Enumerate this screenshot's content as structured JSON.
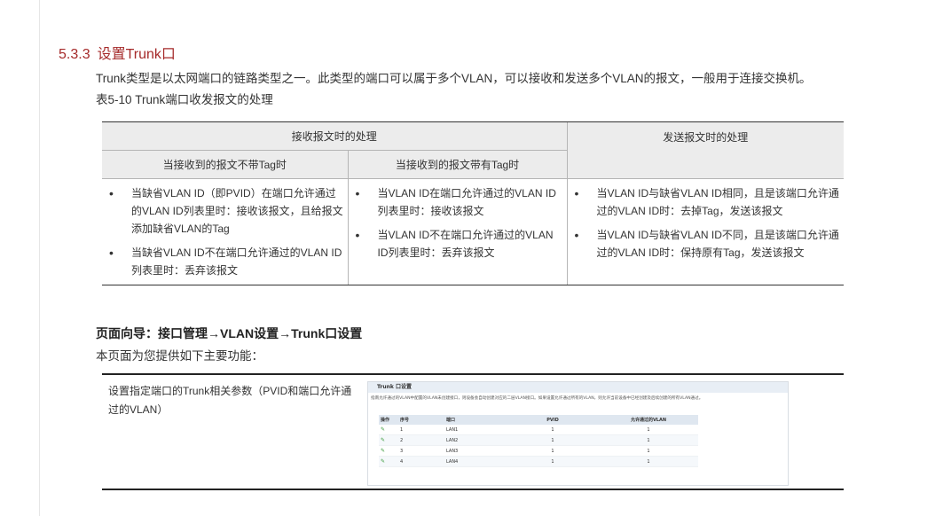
{
  "section": {
    "number": "5.3.3",
    "title": "设置Trunk口"
  },
  "intro_paragraph": "Trunk类型是以太网端口的链路类型之一。此类型的端口可以属于多个VLAN，可以接收和发送多个VLAN的报文，一般用于连接交换机。",
  "table_caption": "表5-10 Trunk端口收发报文的处理",
  "process_table": {
    "receive_header": "接收报文时的处理",
    "send_header": "发送报文时的处理",
    "untagged_header": "当接收到的报文不带Tag时",
    "tagged_header": "当接收到的报文带有Tag时",
    "untagged_items": [
      "当缺省VLAN ID（即PVID）在端口允许通过的VLAN ID列表里时：接收该报文，且给报文添加缺省VLAN的Tag",
      "当缺省VLAN ID不在端口允许通过的VLAN ID列表里时：丢弃该报文"
    ],
    "tagged_items": [
      "当VLAN ID在端口允许通过的VLAN ID列表里时：接收该报文",
      "当VLAN ID不在端口允许通过的VLAN ID列表里时：丢弃该报文"
    ],
    "send_items": [
      "当VLAN ID与缺省VLAN ID相同，且是该端口允许通过的VLAN ID时：去掉Tag，发送该报文",
      "当VLAN ID与缺省VLAN ID不同，且是该端口允许通过的VLAN ID时：保持原有Tag，发送该报文"
    ]
  },
  "page_guide": "页面向导：接口管理→VLAN设置→Trunk口设置",
  "features_intro": "本页面为您提供如下主要功能：",
  "feature": {
    "description": "设置指定端口的Trunk相关参数（PVID和端口允许通过的VLAN）",
    "screenshot": {
      "title": "Trunk 口设置",
      "note": "指南允许通过的VLAN中配置的VLAN未创建接口，则设备会自动创建对应的二层VLAN接口。如果设置允许通过所有的VLAN，则允许当前设备中已经创建及后续创建的所有VLAN通过。",
      "columns": [
        "操作",
        "序号",
        "端口",
        "PVID",
        "允许通过的VLAN"
      ],
      "rows": [
        {
          "no": "1",
          "port": "LAN1",
          "pvid": "1",
          "vlan": "1"
        },
        {
          "no": "2",
          "port": "LAN2",
          "pvid": "1",
          "vlan": "1"
        },
        {
          "no": "3",
          "port": "LAN3",
          "pvid": "1",
          "vlan": "1"
        },
        {
          "no": "4",
          "port": "LAN4",
          "pvid": "1",
          "vlan": "1"
        }
      ],
      "edit_icon": "pencil-icon",
      "colors": {
        "accent_green": "#3a9a3a",
        "header_bg": "#dfe7f0"
      }
    }
  },
  "colors": {
    "section_title": "#a52a2a",
    "table_header_bg": "#ececec"
  }
}
